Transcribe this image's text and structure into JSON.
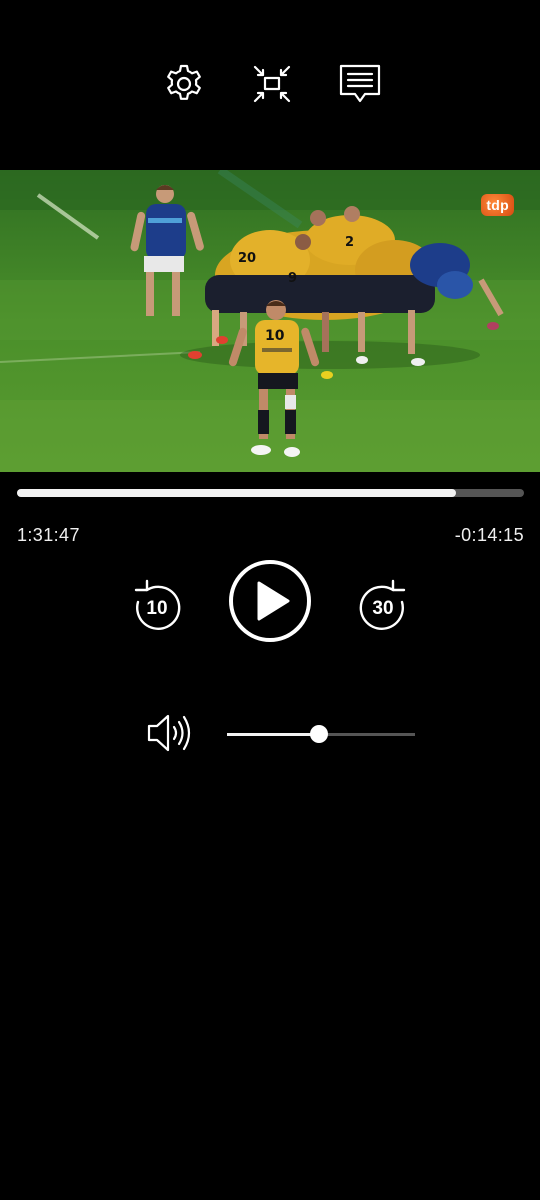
{
  "top_bar": {
    "settings_icon": "gear-icon",
    "fullscreen_icon": "exit-fullscreen-icon",
    "captions_icon": "subtitles-icon"
  },
  "video": {
    "broadcaster_logo": "tdp",
    "scene": "rugby-scrum"
  },
  "playback": {
    "progress": 0.866,
    "elapsed": "1:31:47",
    "remaining": "-0:14:15"
  },
  "controls": {
    "rewind_seconds": "10",
    "forward_seconds": "30",
    "play_icon": "play-icon",
    "rewind_icon": "rewind-icon",
    "forward_icon": "forward-icon"
  },
  "volume": {
    "icon": "speaker-icon",
    "level": 0.49
  },
  "colors": {
    "background": "#000000",
    "accent": "#f2f2f2",
    "track": "#555555",
    "logo": "#e8591a"
  }
}
